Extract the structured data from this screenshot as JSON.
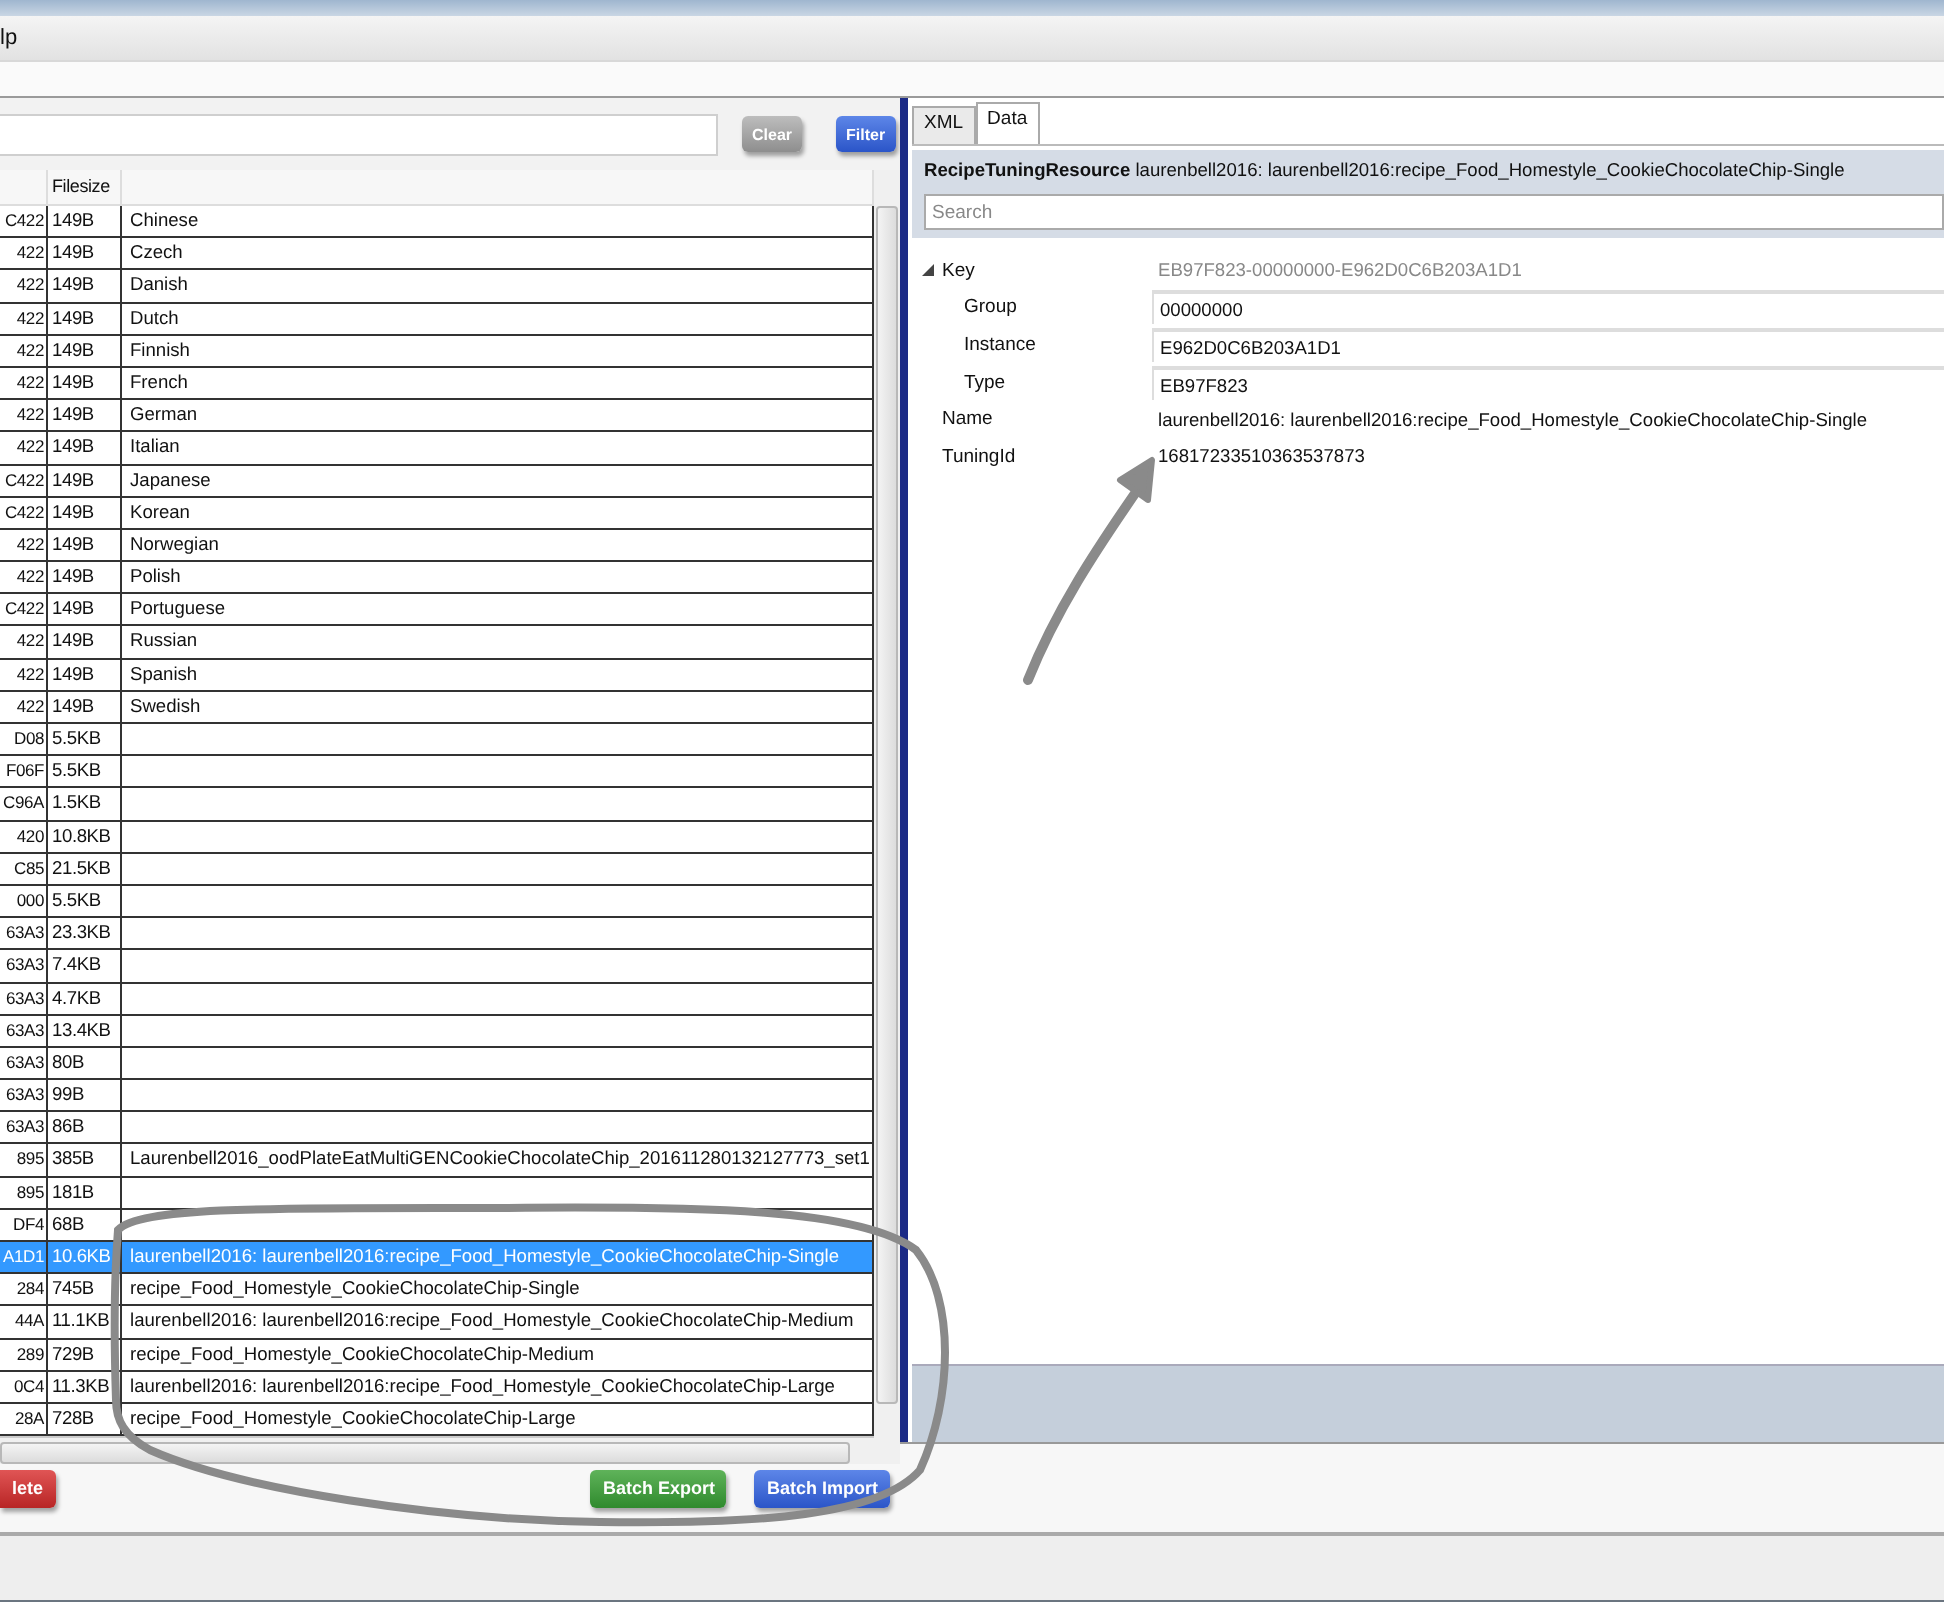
{
  "menu": {
    "partial_label": "lp"
  },
  "filter_bar": {
    "buttons": [
      {
        "label": "Clear",
        "kind": "clear"
      },
      {
        "label": "Filter",
        "kind": "filter"
      }
    ]
  },
  "table": {
    "columns": [
      "",
      "Filesize",
      ""
    ],
    "rows": [
      {
        "id": "C422",
        "size": "149B",
        "name": "Chinese",
        "selected": false
      },
      {
        "id": "422",
        "size": "149B",
        "name": "Czech",
        "selected": false
      },
      {
        "id": "422",
        "size": "149B",
        "name": "Danish",
        "selected": false
      },
      {
        "id": "422",
        "size": "149B",
        "name": "Dutch",
        "selected": false
      },
      {
        "id": "422",
        "size": "149B",
        "name": "Finnish",
        "selected": false
      },
      {
        "id": "422",
        "size": "149B",
        "name": "French",
        "selected": false
      },
      {
        "id": "422",
        "size": "149B",
        "name": "German",
        "selected": false
      },
      {
        "id": "422",
        "size": "149B",
        "name": "Italian",
        "selected": false
      },
      {
        "id": "C422",
        "size": "149B",
        "name": "Japanese",
        "selected": false
      },
      {
        "id": "C422",
        "size": "149B",
        "name": "Korean",
        "selected": false
      },
      {
        "id": "422",
        "size": "149B",
        "name": "Norwegian",
        "selected": false
      },
      {
        "id": "422",
        "size": "149B",
        "name": "Polish",
        "selected": false
      },
      {
        "id": "C422",
        "size": "149B",
        "name": "Portuguese",
        "selected": false
      },
      {
        "id": "422",
        "size": "149B",
        "name": "Russian",
        "selected": false
      },
      {
        "id": "422",
        "size": "149B",
        "name": "Spanish",
        "selected": false
      },
      {
        "id": "422",
        "size": "149B",
        "name": "Swedish",
        "selected": false
      },
      {
        "id": "D08",
        "size": "5.5KB",
        "selected": false
      },
      {
        "id": "F06F",
        "size": "5.5KB",
        "selected": false
      },
      {
        "id": "C96A",
        "size": "1.5KB",
        "selected": false
      },
      {
        "id": "420",
        "size": "10.8KB",
        "selected": false
      },
      {
        "id": "C85",
        "size": "21.5KB",
        "selected": false
      },
      {
        "id": "000",
        "size": "5.5KB",
        "selected": false
      },
      {
        "id": "63A3",
        "size": "23.3KB",
        "selected": false
      },
      {
        "id": "63A3",
        "size": "7.4KB",
        "selected": false
      },
      {
        "id": "63A3",
        "size": "4.7KB",
        "selected": false
      },
      {
        "id": "63A3",
        "size": "13.4KB",
        "selected": false
      },
      {
        "id": "63A3",
        "size": "80B",
        "selected": false
      },
      {
        "id": "63A3",
        "size": "99B",
        "selected": false
      },
      {
        "id": "63A3",
        "size": "86B",
        "selected": false
      },
      {
        "id": "895",
        "size": "385B",
        "name": "Laurenbell2016_oodPlateEatMultiGENCookieChocolateChip_201611280132127773_set1",
        "selected": false
      },
      {
        "id": "895",
        "size": "181B",
        "selected": false
      },
      {
        "id": "DF4",
        "size": "68B",
        "selected": false
      },
      {
        "id": "A1D1",
        "size": "10.6KB",
        "name": "laurenbell2016: laurenbell2016:recipe_Food_Homestyle_CookieChocolateChip-Single",
        "selected": true
      },
      {
        "id": "284",
        "size": "745B",
        "name": "recipe_Food_Homestyle_CookieChocolateChip-Single",
        "selected": false
      },
      {
        "id": "44A",
        "size": "11.1KB",
        "name": "laurenbell2016: laurenbell2016:recipe_Food_Homestyle_CookieChocolateChip-Medium",
        "selected": false
      },
      {
        "id": "289",
        "size": "729B",
        "name": "recipe_Food_Homestyle_CookieChocolateChip-Medium",
        "selected": false
      },
      {
        "id": "0C4",
        "size": "11.3KB",
        "name": "laurenbell2016: laurenbell2016:recipe_Food_Homestyle_CookieChocolateChip-Large",
        "selected": false
      },
      {
        "id": "28A",
        "size": "728B",
        "name": "recipe_Food_Homestyle_CookieChocolateChip-Large",
        "selected": false
      }
    ]
  },
  "bottom_buttons": [
    {
      "label": "lete",
      "kind": "delete"
    },
    {
      "label": "Batch Export",
      "kind": "export"
    },
    {
      "label": "Batch Import",
      "kind": "import"
    }
  ],
  "tabs": [
    {
      "label": "XML",
      "selected": false
    },
    {
      "label": "Data",
      "selected": true
    }
  ],
  "resource": {
    "type": "RecipeTuningResource",
    "name": "laurenbell2016: laurenbell2016:recipe_Food_Homestyle_CookieChocolateChip-Single"
  },
  "search": {
    "placeholder": "Search"
  },
  "properties": [
    {
      "label": "Key",
      "value": "EB97F823-00000000-E962D0C6B203A1D1",
      "expanded": true,
      "children": [
        {
          "label": "Group",
          "value": "00000000"
        },
        {
          "label": "Instance",
          "value": "E962D0C6B203A1D1"
        },
        {
          "label": "Type",
          "value": "EB97F823"
        }
      ]
    },
    {
      "label": "Name",
      "value": "laurenbell2016: laurenbell2016:recipe_Food_Homestyle_CookieChocolateChip-Single"
    },
    {
      "label": "TuningId",
      "value": "16817233510363537873"
    }
  ]
}
